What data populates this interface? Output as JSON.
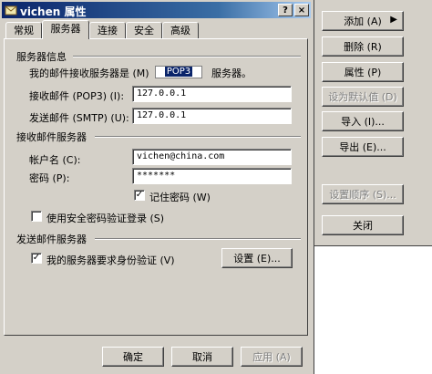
{
  "window": {
    "title": "vichen 属性",
    "help_btn": "?",
    "close_btn": "×"
  },
  "tabs": [
    "常规",
    "服务器",
    "连接",
    "安全",
    "高级"
  ],
  "active_tab": 1,
  "server_info": {
    "header": "服务器信息",
    "incoming_label": "我的邮件接收服务器是 (M)",
    "incoming_type": "POP3",
    "incoming_suffix": "服务器。",
    "pop3_label": "接收邮件 (POP3) (I):",
    "pop3_value": "127.0.0.1",
    "smtp_label": "发送邮件 (SMTP) (U):",
    "smtp_value": "127.0.0.1"
  },
  "incoming_server": {
    "header": "接收邮件服务器",
    "account_label": "帐户名 (C):",
    "account_value": "vichen@china.com",
    "password_label": "密码 (P):",
    "password_value": "*******",
    "remember_label": "记住密码 (W)",
    "remember_checked": "✓",
    "spa_label": "使用安全密码验证登录 (S)"
  },
  "outgoing_server": {
    "header": "发送邮件服务器",
    "auth_label": "我的服务器要求身份验证 (V)",
    "auth_checked": "✓",
    "settings_button": "设置 (E)..."
  },
  "footer": {
    "ok": "确定",
    "cancel": "取消",
    "apply": "应用 (A)"
  },
  "side_panel": {
    "add": "添加 (A)",
    "remove": "删除 (R)",
    "properties": "属性 (P)",
    "set_default": "设为默认值 (D)",
    "import": "导入 (I)...",
    "export": "导出 (E)...",
    "set_order": "设置顺序 (S)...",
    "close": "关闭",
    "arrow": "▶"
  }
}
